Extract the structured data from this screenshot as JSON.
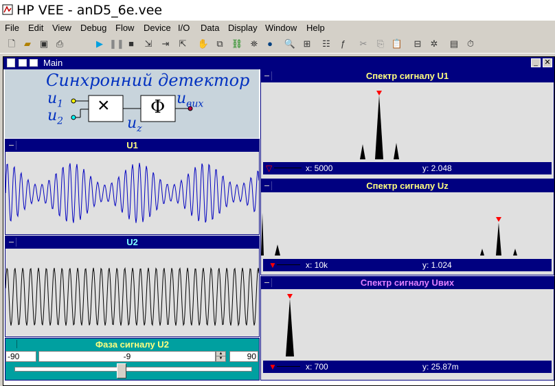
{
  "window": {
    "title": "HP VEE - anD5_6e.vee"
  },
  "menu": [
    "File",
    "Edit",
    "View",
    "Debug",
    "Flow",
    "Device",
    "I/O",
    "Data",
    "Display",
    "Window",
    "Help"
  ],
  "main": {
    "title": "Main"
  },
  "diagram": {
    "title": "Синхронний детектор",
    "u1": "u",
    "u1_sub": "1",
    "u2": "u",
    "u2_sub": "2",
    "uz": "u",
    "uz_sub": "z",
    "multiply": "×",
    "phi": "Φ",
    "uout": "u",
    "uout_sub": "вих"
  },
  "plots": {
    "u1": {
      "title": "U1"
    },
    "u2": {
      "title": "U2"
    }
  },
  "spectra": [
    {
      "title": "Спектр сигналу  U1",
      "title_color": "#ffff80",
      "x_label": "x: 5000",
      "y_label": "y: 2.048"
    },
    {
      "title": "Спектр сигналу  Uz",
      "title_color": "#ffff80",
      "x_label": "x: 10k",
      "y_label": "y: 1.024"
    },
    {
      "title": "Спектр сигналу  Uвих",
      "title_color": "#e080ff",
      "x_label": "x: 700",
      "y_label": "y: 25.87m"
    }
  ],
  "phase": {
    "title": "Фаза сигналу  U2",
    "min": "-90",
    "value": "-9",
    "max": "90",
    "level": 0.45
  },
  "colors": {
    "waveform": "#0000c0",
    "u2_waveform": "#000000",
    "accent": "#000080",
    "phase_bar": "#00a0a0"
  }
}
